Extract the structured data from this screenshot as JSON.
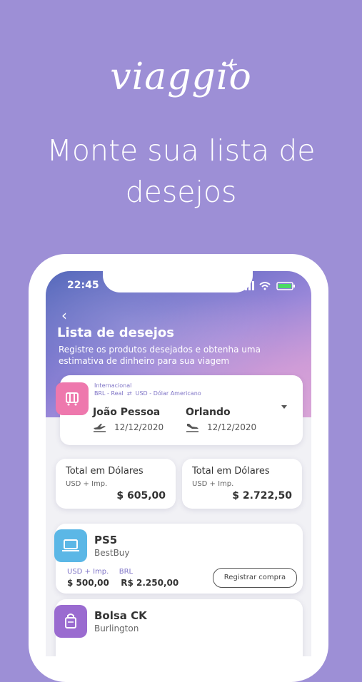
{
  "promo": {
    "logo": "viaggio",
    "headline_line1": "Monte sua lista de",
    "headline_line2": "desejos"
  },
  "status_bar": {
    "time": "22:45"
  },
  "screen": {
    "title": "Lista de desejos",
    "subtitle": "Registre os produtos desejados e obtenha uma estimativa de dinheiro para sua viagem"
  },
  "trip": {
    "type": "Internacional",
    "currency_from": "BRL - Real",
    "currency_to": "USD - Dólar Americano",
    "origin": "João Pessoa",
    "destination": "Orlando",
    "departure_date": "12/12/2020",
    "return_date": "12/12/2020"
  },
  "totals": [
    {
      "label": "Total em Dólares",
      "sub": "USD + Imp.",
      "value": "$ 605,00"
    },
    {
      "label": "Total em Dólares",
      "sub": "USD + Imp.",
      "value": "$ 2.722,50"
    }
  ],
  "products": [
    {
      "name": "PS5",
      "store": "BestBuy",
      "curr_usd_label": "USD + Imp.",
      "curr_brl_label": "BRL",
      "price_usd": "$ 500,00",
      "price_brl": "R$ 2.250,00",
      "button": "Registrar compra",
      "icon": "laptop-icon",
      "color": "#5bb7e6"
    },
    {
      "name": "Bolsa CK",
      "store": "Burlington",
      "icon": "bag-icon",
      "color": "#9a6bd0"
    }
  ],
  "colors": {
    "background": "#9d8fd6",
    "accent": "#7f74c6",
    "trip_icon": "#ee78ad"
  }
}
